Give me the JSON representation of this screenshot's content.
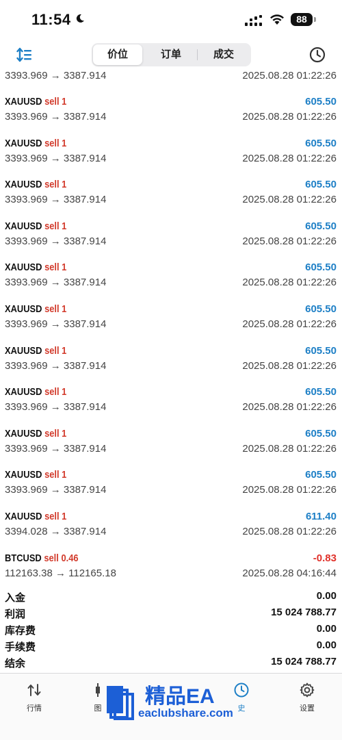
{
  "status_bar": {
    "time": "11:54",
    "battery": "88"
  },
  "toolbar": {
    "tabs": [
      {
        "label": "价位",
        "active": true
      },
      {
        "label": "订单",
        "active": false
      },
      {
        "label": "成交",
        "active": false
      }
    ]
  },
  "deals": [
    {
      "symbol": "",
      "side": "",
      "profit": "",
      "prices": "3393.969 → 3387.914",
      "time": "2025.08.28 01:22:26"
    },
    {
      "symbol": "XAUUSD",
      "side": "sell 1",
      "profit": "605.50",
      "prices": "3393.969 → 3387.914",
      "time": "2025.08.28 01:22:26"
    },
    {
      "symbol": "XAUUSD",
      "side": "sell 1",
      "profit": "605.50",
      "prices": "3393.969 → 3387.914",
      "time": "2025.08.28 01:22:26"
    },
    {
      "symbol": "XAUUSD",
      "side": "sell 1",
      "profit": "605.50",
      "prices": "3393.969 → 3387.914",
      "time": "2025.08.28 01:22:26"
    },
    {
      "symbol": "XAUUSD",
      "side": "sell 1",
      "profit": "605.50",
      "prices": "3393.969 → 3387.914",
      "time": "2025.08.28 01:22:26"
    },
    {
      "symbol": "XAUUSD",
      "side": "sell 1",
      "profit": "605.50",
      "prices": "3393.969 → 3387.914",
      "time": "2025.08.28 01:22:26"
    },
    {
      "symbol": "XAUUSD",
      "side": "sell 1",
      "profit": "605.50",
      "prices": "3393.969 → 3387.914",
      "time": "2025.08.28 01:22:26"
    },
    {
      "symbol": "XAUUSD",
      "side": "sell 1",
      "profit": "605.50",
      "prices": "3393.969 → 3387.914",
      "time": "2025.08.28 01:22:26"
    },
    {
      "symbol": "XAUUSD",
      "side": "sell 1",
      "profit": "605.50",
      "prices": "3393.969 → 3387.914",
      "time": "2025.08.28 01:22:26"
    },
    {
      "symbol": "XAUUSD",
      "side": "sell 1",
      "profit": "605.50",
      "prices": "3393.969 → 3387.914",
      "time": "2025.08.28 01:22:26"
    },
    {
      "symbol": "XAUUSD",
      "side": "sell 1",
      "profit": "605.50",
      "prices": "3393.969 → 3387.914",
      "time": "2025.08.28 01:22:26"
    },
    {
      "symbol": "XAUUSD",
      "side": "sell 1",
      "profit": "611.40",
      "prices": "3394.028 → 3387.914",
      "time": "2025.08.28 01:22:26"
    },
    {
      "symbol": "BTCUSD",
      "side": "sell 0.46",
      "profit": "-0.83",
      "prices": "112163.38 → 112165.18",
      "time": "2025.08.28 04:16:44"
    }
  ],
  "summary": [
    {
      "label": "入金",
      "value": "0.00"
    },
    {
      "label": "利润",
      "value": "15 024 788.77"
    },
    {
      "label": "库存费",
      "value": "0.00"
    },
    {
      "label": "手续费",
      "value": "0.00"
    },
    {
      "label": "结余",
      "value": "15 024 788.77"
    }
  ],
  "bottom_nav": [
    {
      "label": "行情",
      "icon": "arrows-updown-icon",
      "active": false
    },
    {
      "label": "图",
      "icon": "candlestick-icon",
      "active": false
    },
    {
      "label": "史",
      "icon": "history-clock-icon",
      "active": true
    },
    {
      "label": "设置",
      "icon": "gear-icon",
      "active": false
    }
  ],
  "watermark": {
    "title": "精品EA",
    "subtitle": "eaclubshare.com"
  },
  "colors": {
    "sell": "#d23a2b",
    "profit_positive": "#1d7fc6",
    "profit_negative": "#e0312a",
    "accent": "#1d7fc6",
    "watermark": "#1c5fd6"
  }
}
